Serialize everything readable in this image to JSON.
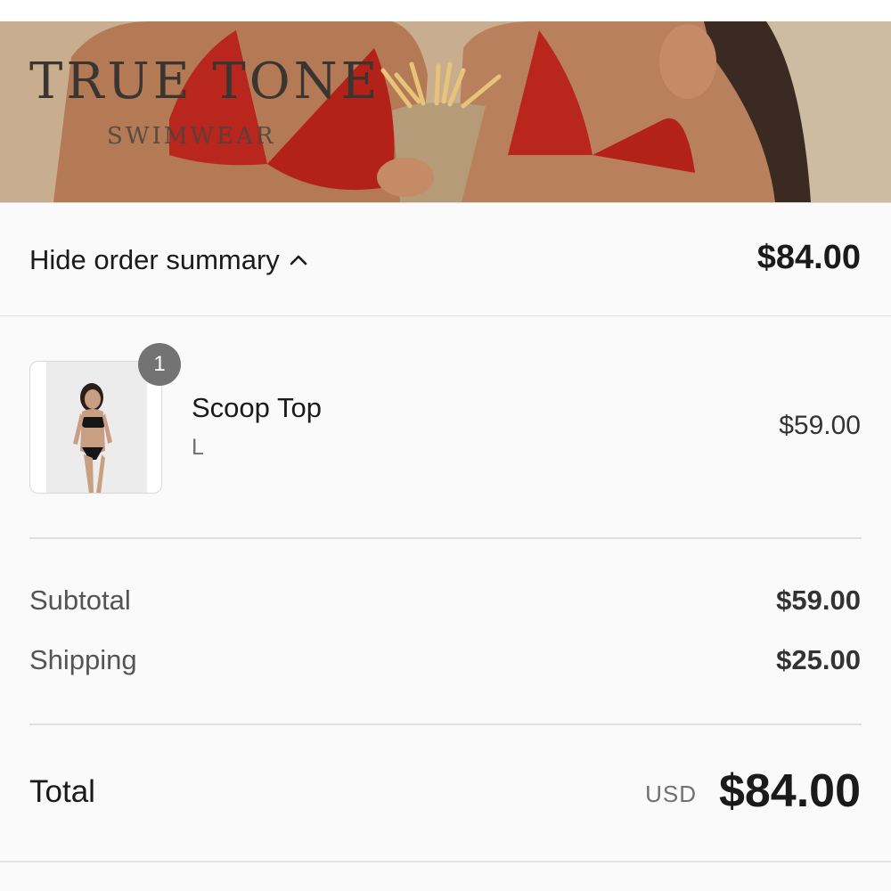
{
  "brand": {
    "name": "TRUE TONE",
    "subtitle": "SWIMWEAR"
  },
  "summary_toggle": {
    "label": "Hide order summary",
    "icon": "chevron-up-icon",
    "total": "$84.00"
  },
  "line_items": [
    {
      "name": "Scoop Top",
      "variant": "L",
      "quantity": "1",
      "price": "$59.00"
    }
  ],
  "costs": {
    "subtotal_label": "Subtotal",
    "subtotal_value": "$59.00",
    "shipping_label": "Shipping",
    "shipping_value": "$25.00"
  },
  "total": {
    "label": "Total",
    "currency": "USD",
    "value": "$84.00"
  },
  "colors": {
    "swimsuit_red": "#b8261d",
    "text_dark": "#1a1a1a",
    "badge_gray": "#737373"
  }
}
